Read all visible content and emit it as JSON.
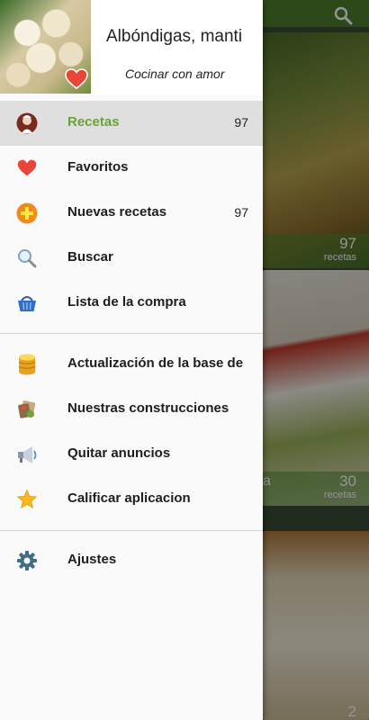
{
  "header": {
    "title": "Albóndigas, manti",
    "subtitle": "Cocinar con amor"
  },
  "menu": {
    "items": [
      {
        "label": "Recetas",
        "count": "97",
        "icon": "chef-icon",
        "active": true
      },
      {
        "label": "Favoritos",
        "count": "",
        "icon": "heart-icon"
      },
      {
        "label": "Nuevas recetas",
        "count": "97",
        "icon": "plus-icon"
      },
      {
        "label": "Buscar",
        "count": "",
        "icon": "search-icon"
      },
      {
        "label": "Lista de la compra",
        "count": "",
        "icon": "basket-icon"
      },
      {
        "label": "Actualización de la base de",
        "count": "",
        "icon": "database-icon"
      },
      {
        "label": "Nuestras construcciones",
        "count": "",
        "icon": "apps-icon"
      },
      {
        "label": "Quitar anuncios",
        "count": "",
        "icon": "megaphone-icon"
      },
      {
        "label": "Calificar aplicacion",
        "count": "",
        "icon": "star-icon"
      },
      {
        "label": "Ajustes",
        "count": "",
        "icon": "gear-icon"
      }
    ]
  },
  "background_cards": [
    {
      "count": "97",
      "unit": "recetas"
    },
    {
      "count": "30",
      "unit": "recetas",
      "label_fragment": "a"
    },
    {
      "count": "2"
    }
  ],
  "colors": {
    "accent_green": "#6aa334",
    "toolbar_green": "#4e7f2e",
    "active_row": "#dfdfdf"
  }
}
